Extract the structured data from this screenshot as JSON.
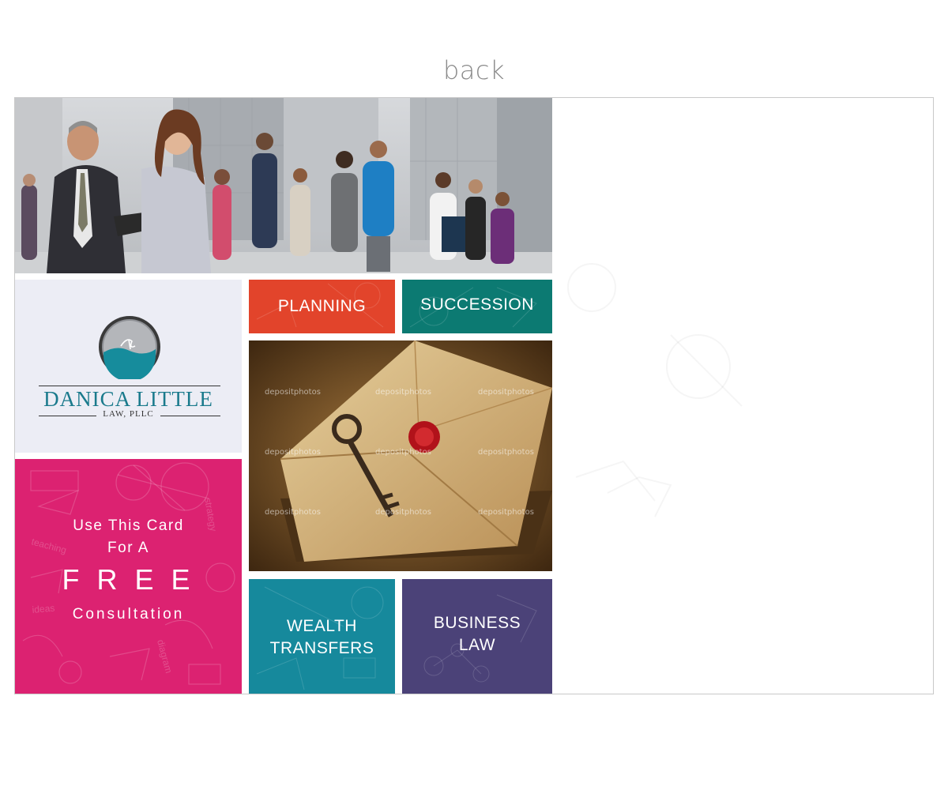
{
  "caption": "back",
  "brand": {
    "name": "DANICA LITTLE",
    "sub": "LAW, PLLC"
  },
  "promo": {
    "line1": "Use  This  Card",
    "line2": "For A",
    "line3": "F R E E",
    "line4": "Consultation"
  },
  "tiles": {
    "planning": "PLANNING",
    "succession": "SUCCESSION",
    "wealth1": "WEALTH",
    "wealth2": "TRANSFERS",
    "business1": "BUSINESS",
    "business2": "LAW"
  },
  "watermark": "depositphotos",
  "colors": {
    "pink": "#dc2271",
    "orange": "#e2442b",
    "teal_dark": "#0c7a72",
    "teal": "#16899c",
    "purple": "#4b4278",
    "logo_text": "#1a7a8c"
  }
}
